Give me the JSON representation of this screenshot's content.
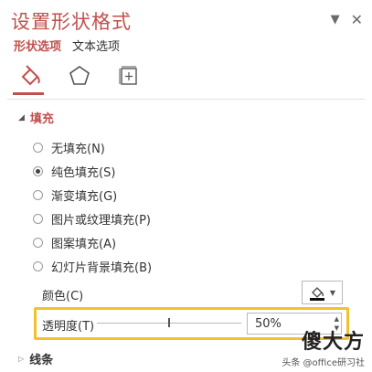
{
  "pane": {
    "title": "设置形状格式",
    "controls": {
      "dropdown": "▼",
      "close": "✕"
    },
    "tabs": [
      {
        "label": "形状选项",
        "active": true
      },
      {
        "label": "文本选项",
        "active": false
      }
    ],
    "icons": [
      "fill-line-icon",
      "effects-pentagon-icon",
      "size-properties-icon"
    ]
  },
  "fill": {
    "heading": "填充",
    "options": [
      {
        "label": "无填充(N)",
        "selected": false
      },
      {
        "label": "纯色填充(S)",
        "selected": true
      },
      {
        "label": "渐变填充(G)",
        "selected": false
      },
      {
        "label": "图片或纹理填充(P)",
        "selected": false
      },
      {
        "label": "图案填充(A)",
        "selected": false
      },
      {
        "label": "幻灯片背景填充(B)",
        "selected": false
      }
    ],
    "color_label": "颜色(C)",
    "transparency_label": "透明度(T)",
    "transparency_value": "50%",
    "transparency_fraction": 0.5
  },
  "line": {
    "heading": "线条"
  },
  "watermark": {
    "brand": "傻大方",
    "sub": "头条 @office研习社"
  },
  "colors": {
    "accent": "#c0504d",
    "highlight": "#f3c12f"
  }
}
